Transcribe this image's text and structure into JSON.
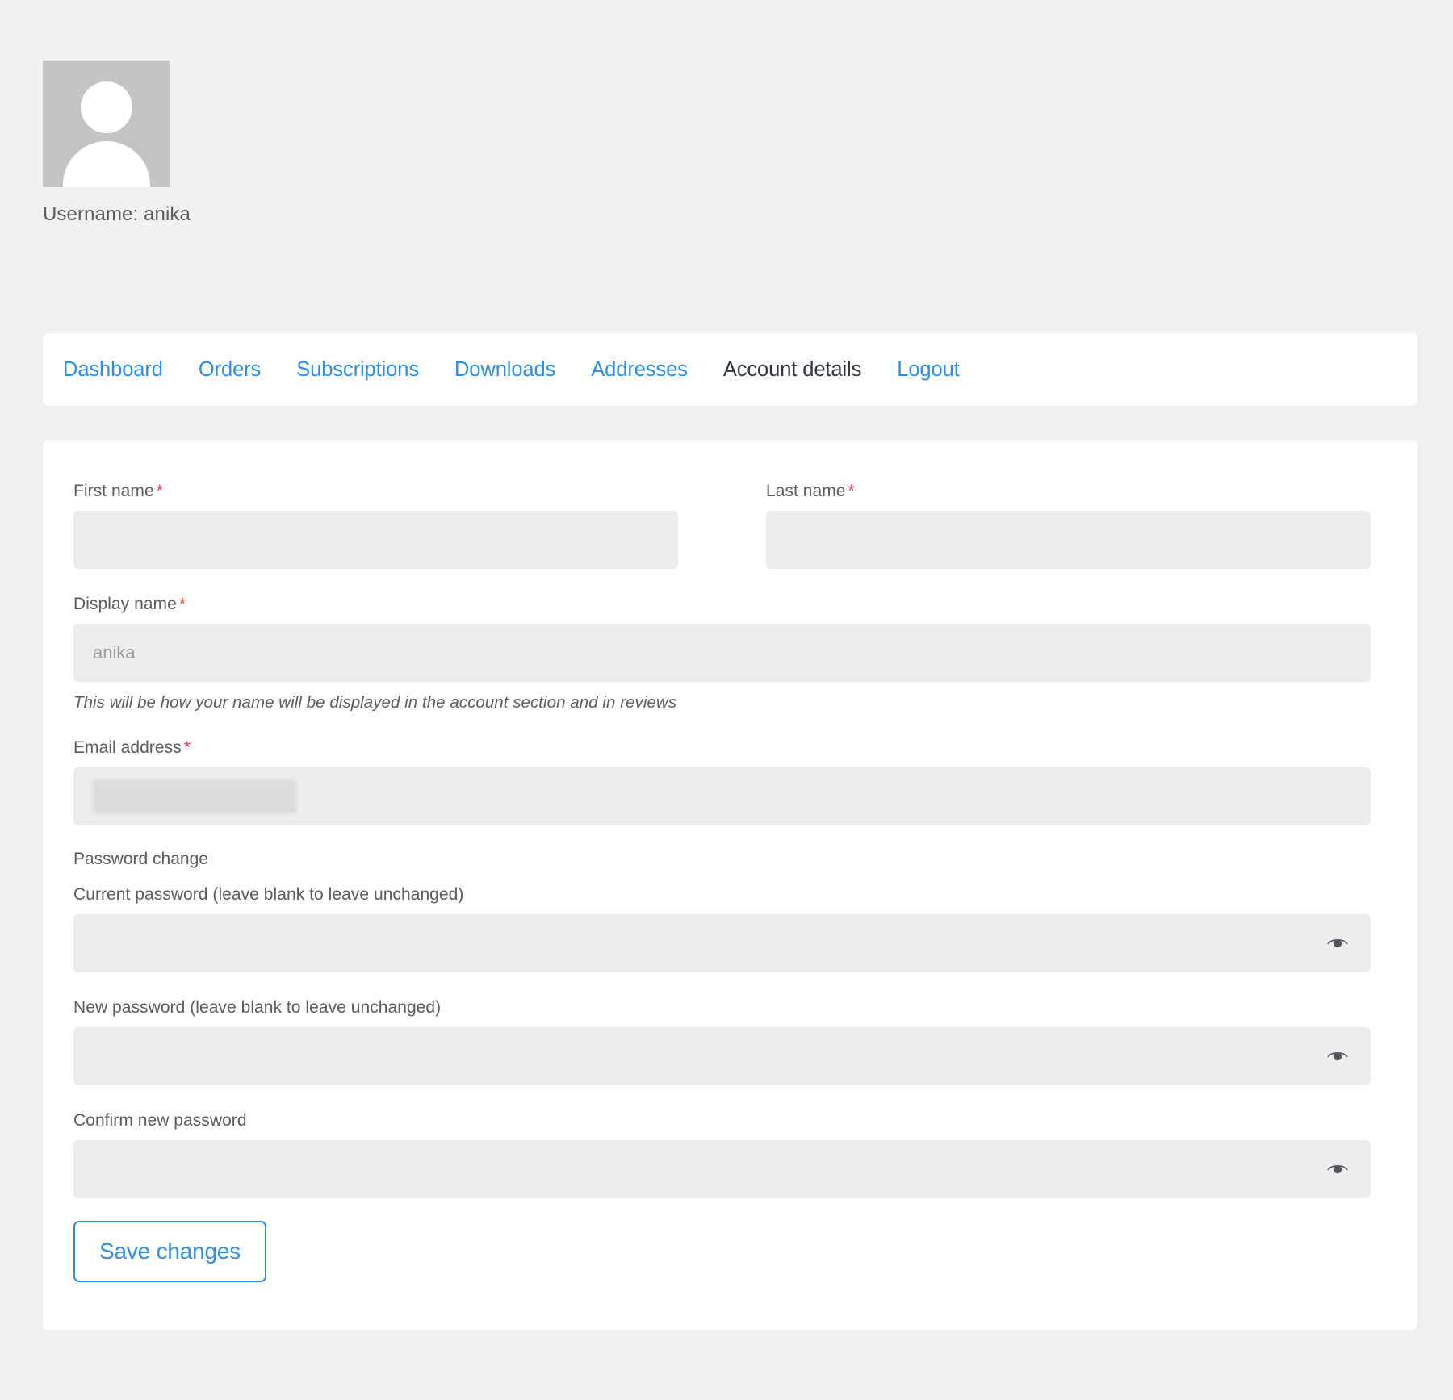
{
  "account": {
    "avatar_alt": "user-avatar-placeholder",
    "username_label": "Username: anika"
  },
  "nav": {
    "items": [
      {
        "label": "Dashboard",
        "active": false
      },
      {
        "label": "Orders",
        "active": false
      },
      {
        "label": "Subscriptions",
        "active": false
      },
      {
        "label": "Downloads",
        "active": false
      },
      {
        "label": "Addresses",
        "active": false
      },
      {
        "label": "Account details",
        "active": true
      },
      {
        "label": "Logout",
        "active": false
      }
    ]
  },
  "form": {
    "first_name": {
      "label": "First name",
      "required_marker": "*",
      "value": "",
      "placeholder": ""
    },
    "last_name": {
      "label": "Last name",
      "required_marker": "*",
      "value": "",
      "placeholder": ""
    },
    "display_name": {
      "label": "Display name",
      "required_marker": "*",
      "value": "anika",
      "help": "This will be how your name will be displayed in the account section and in reviews"
    },
    "email": {
      "label": "Email address",
      "required_marker": "*",
      "value": "",
      "redacted": true
    },
    "password_section_title": "Password change",
    "current_password": {
      "label": "Current password (leave blank to leave unchanged)",
      "value": "",
      "reveal_icon": "eye-icon"
    },
    "new_password": {
      "label": "New password (leave blank to leave unchanged)",
      "value": "",
      "reveal_icon": "eye-icon"
    },
    "confirm_password": {
      "label": "Confirm new password",
      "value": "",
      "reveal_icon": "eye-icon"
    },
    "save_button": "Save changes"
  },
  "colors": {
    "link_blue": "#2e8de6",
    "text_gray": "#5b5b5b",
    "required_red": "#e8384f",
    "page_bg": "#f1f1f1",
    "input_bg": "#ededed"
  }
}
